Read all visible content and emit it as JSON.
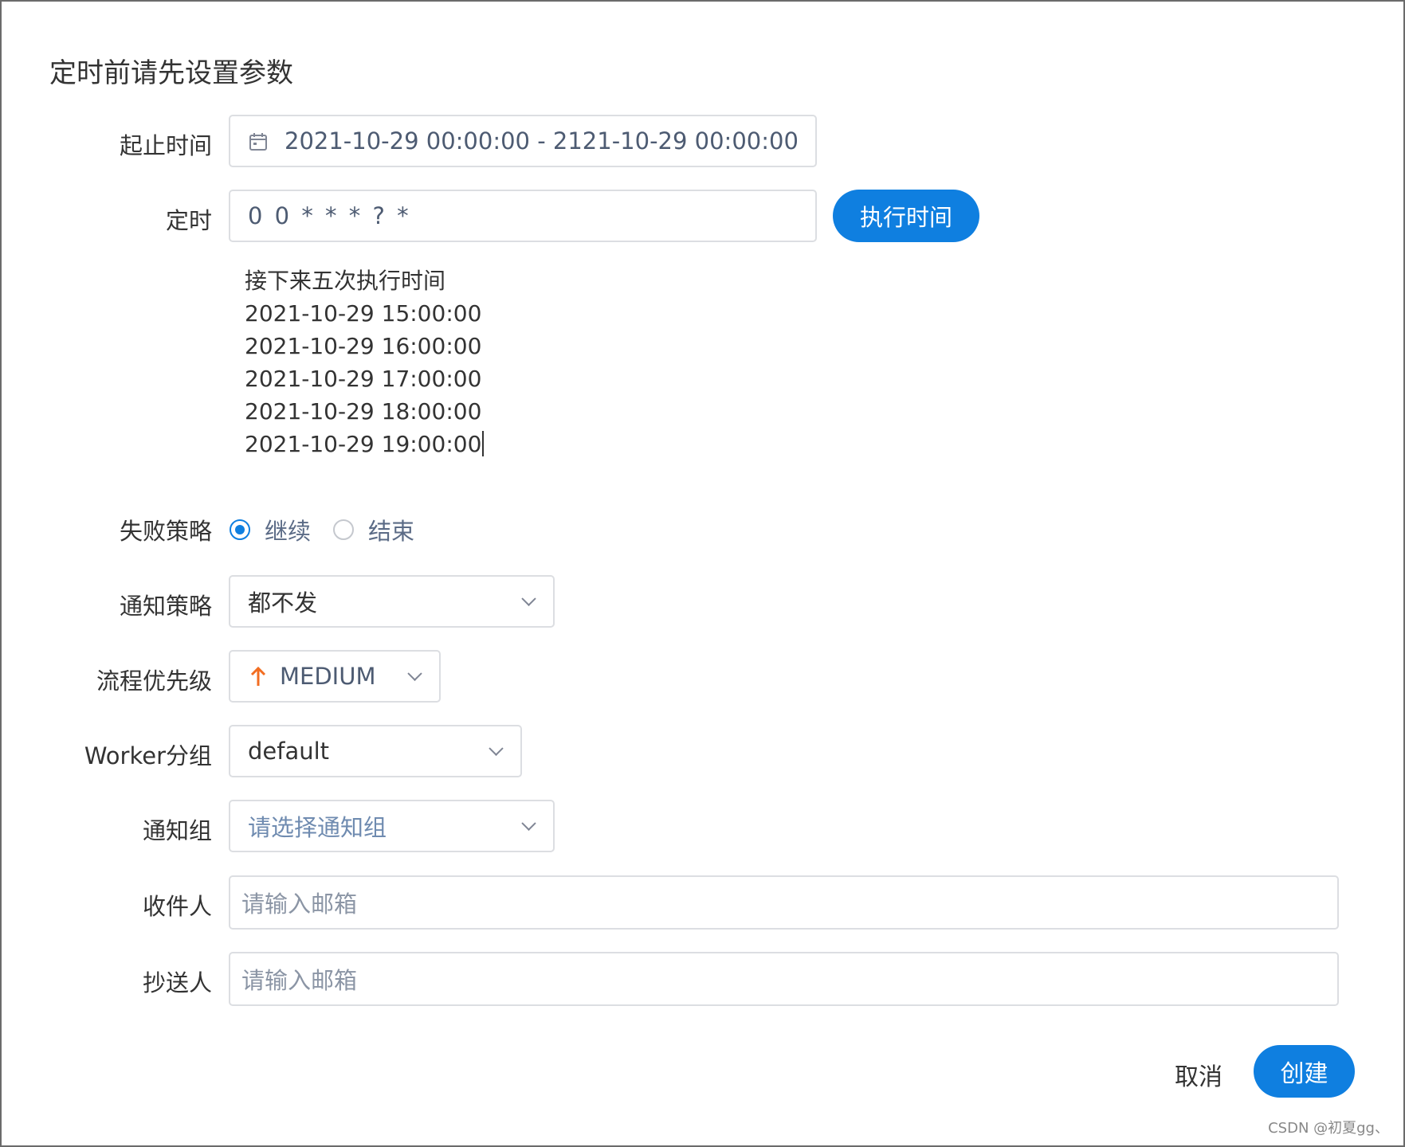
{
  "dialog": {
    "title": "定时前请先设置参数"
  },
  "form": {
    "start_end_time": {
      "label": "起止时间",
      "value": "2021-10-29 00:00:00 - 2121-10-29 00:00:00",
      "icon": "calendar-icon"
    },
    "timing": {
      "label": "定时",
      "value": "0 0 * * * ? *",
      "button_label": "执行时间"
    },
    "next_runs": {
      "heading": "接下来五次执行时间",
      "times": [
        "2021-10-29 15:00:00",
        "2021-10-29 16:00:00",
        "2021-10-29 17:00:00",
        "2021-10-29 18:00:00",
        "2021-10-29 19:00:00"
      ]
    },
    "failure_strategy": {
      "label": "失败策略",
      "options": [
        "继续",
        "结束"
      ],
      "selected": "继续"
    },
    "notify_strategy": {
      "label": "通知策略",
      "value": "都不发"
    },
    "priority": {
      "label": "流程优先级",
      "value": "MEDIUM",
      "icon": "arrow-up-icon",
      "icon_color": "#f26d21"
    },
    "worker_group": {
      "label": "Worker分组",
      "value": "default"
    },
    "notify_group": {
      "label": "通知组",
      "placeholder": "请选择通知组"
    },
    "recipients": {
      "label": "收件人",
      "placeholder": "请输入邮箱"
    },
    "cc": {
      "label": "抄送人",
      "placeholder": "请输入邮箱"
    }
  },
  "footer": {
    "cancel_label": "取消",
    "create_label": "创建"
  },
  "watermark": "CSDN @初夏gg、",
  "colors": {
    "primary": "#0f7fe0",
    "priority_medium": "#f26d21"
  }
}
